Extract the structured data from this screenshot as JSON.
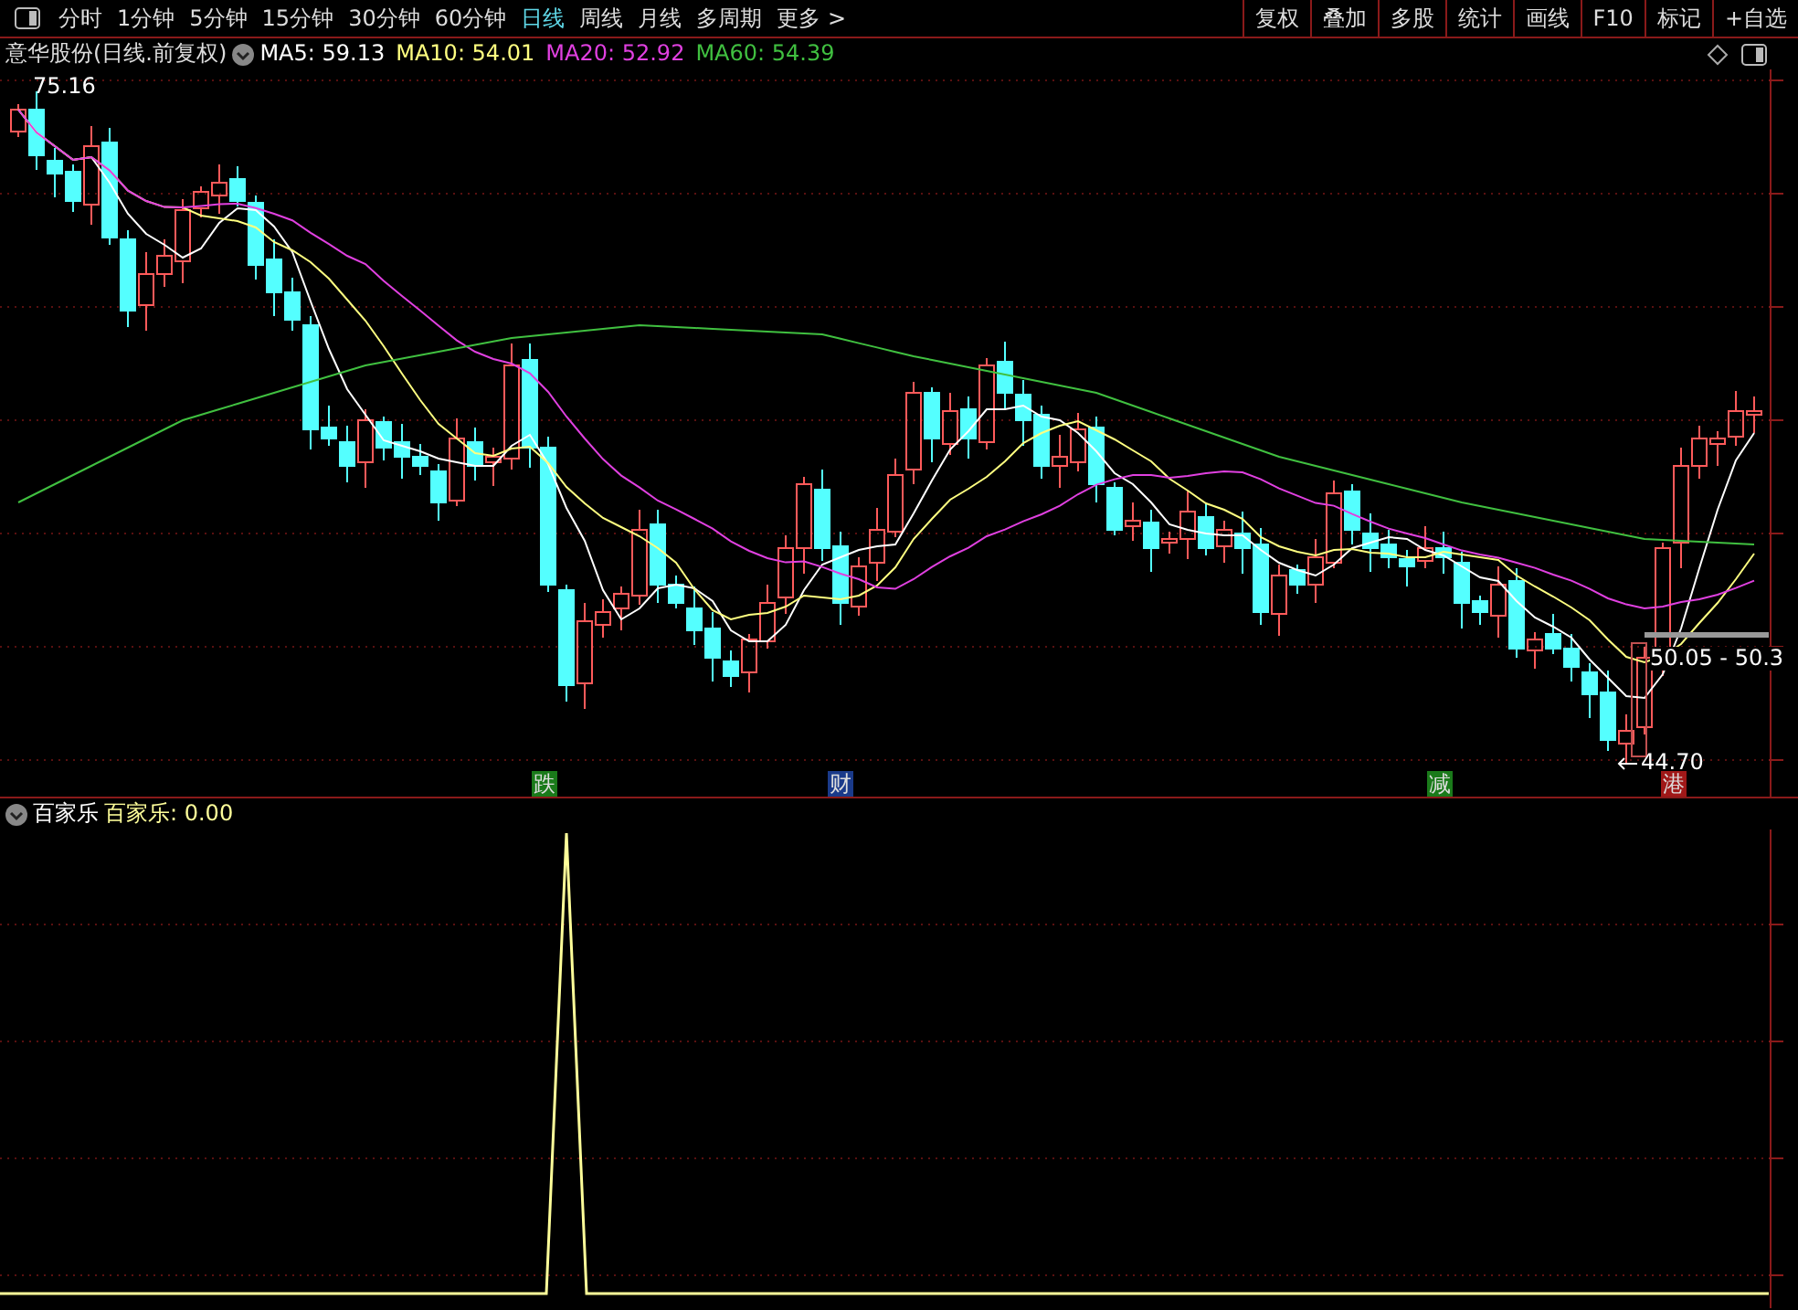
{
  "toolbar": {
    "periods": [
      {
        "label": "分时",
        "selected": false
      },
      {
        "label": "1分钟",
        "selected": false
      },
      {
        "label": "5分钟",
        "selected": false
      },
      {
        "label": "15分钟",
        "selected": false
      },
      {
        "label": "30分钟",
        "selected": false
      },
      {
        "label": "60分钟",
        "selected": false
      },
      {
        "label": "日线",
        "selected": true
      },
      {
        "label": "周线",
        "selected": false
      },
      {
        "label": "月线",
        "selected": false
      },
      {
        "label": "多周期",
        "selected": false
      },
      {
        "label": "更多 >",
        "selected": false
      }
    ],
    "actions": [
      "复权",
      "叠加",
      "多股",
      "统计",
      "画线",
      "F10",
      "标记",
      "+自选"
    ]
  },
  "legend": {
    "title": "意华股份(日线.前复权)",
    "averages": [
      {
        "label": "MA5: 59.13",
        "color": "#ffffff"
      },
      {
        "label": "MA10: 54.01",
        "color": "#ffff80"
      },
      {
        "label": "MA20: 52.92",
        "color": "#e040e0"
      },
      {
        "label": "MA60: 54.39",
        "color": "#40c040"
      }
    ]
  },
  "price_chart": {
    "high_label": "75.16",
    "low_label": "44.70",
    "range_label": "50.05 - 50.3",
    "markers": [
      {
        "label": "跌",
        "color": "#1a7a1a"
      },
      {
        "label": "财",
        "color": "#1a3a8a"
      },
      {
        "label": "减",
        "color": "#1a7a1a"
      },
      {
        "label": "港",
        "color": "#a01818"
      }
    ]
  },
  "indicator": {
    "name": "百家乐",
    "reading": "百家乐: 0.00"
  }
}
